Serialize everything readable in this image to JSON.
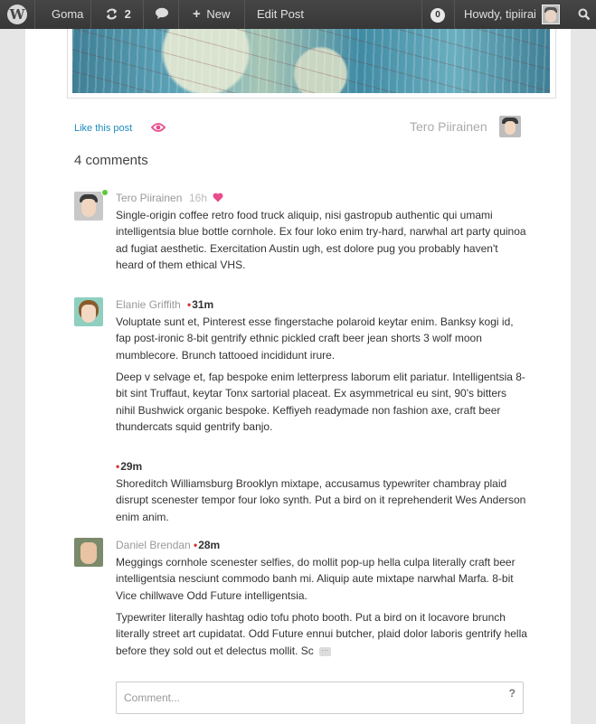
{
  "adminbar": {
    "logo_glyph": "W",
    "site_name": "Goma",
    "updates_count": "2",
    "new_label": "New",
    "edit_label": "Edit Post",
    "notifications_count": "0",
    "greeting": "Howdy, tipiirai",
    "icons": [
      "wordpress-logo-icon",
      "refresh-icon",
      "speech-bubble-icon",
      "plus-icon",
      "search-icon"
    ]
  },
  "post": {
    "like_label": "Like this post",
    "author": "Tero Piirainen"
  },
  "comments_heading": "4 comments",
  "comments": [
    {
      "author": "Tero Piirainen",
      "time": "16h",
      "paragraphs": [
        "Single-origin coffee retro food truck aliquip, nisi gastropub authentic qui umami intelligentsia blue bottle cornhole. Ex four loko enim try-hard, narwhal art party quinoa ad fugiat aesthetic. Exercitation Austin ugh, est dolore pug you probably haven't heard of them ethical VHS."
      ]
    },
    {
      "author": "Elanie Griffith",
      "time": "31m",
      "paragraphs": [
        "Voluptate sunt et, Pinterest esse fingerstache polaroid keytar enim. Banksy kogi id, fap post-ironic 8-bit gentrify ethnic pickled craft beer jean shorts 3 wolf moon mumblecore. Brunch tattooed incididunt irure.",
        "Deep v selvage et, fap bespoke enim letterpress laborum elit pariatur. Intelligentsia 8-bit sint Truffaut, keytar Tonx sartorial placeat. Ex asymmetrical eu sint, 90's bitters nihil Bushwick organic bespoke. Keffiyeh readymade non fashion axe, craft beer thundercats squid gentrify banjo."
      ]
    },
    {
      "author": "",
      "time": "29m",
      "paragraphs": [
        "Shoreditch Williamsburg Brooklyn mixtape, accusamus typewriter chambray plaid disrupt scenester tempor four loko synth. Put a bird on it reprehenderit Wes Anderson enim anim."
      ]
    },
    {
      "author": "Daniel Brendan",
      "time": "28m",
      "paragraphs": [
        "Meggings cornhole scenester selfies, do mollit pop-up hella culpa literally craft beer intelligentsia nesciunt commodo banh mi. Aliquip aute mixtape narwhal Marfa. 8-bit Vice chillwave Odd Future intelligentsia.",
        "Typewriter literally hashtag odio tofu photo booth. Put a bird on it locavore brunch literally street art cupidatat. Odd Future ennui butcher, plaid dolor laboris gentrify hella before they sold out et delectus mollit. Sc"
      ]
    }
  ],
  "comment_form": {
    "placeholder": "Comment...",
    "help_glyph": "?"
  },
  "colors": {
    "accent": "#1e8cbe",
    "heart": "#e94b8c",
    "new_dot": "#d63638",
    "online": "#5cc83a"
  }
}
